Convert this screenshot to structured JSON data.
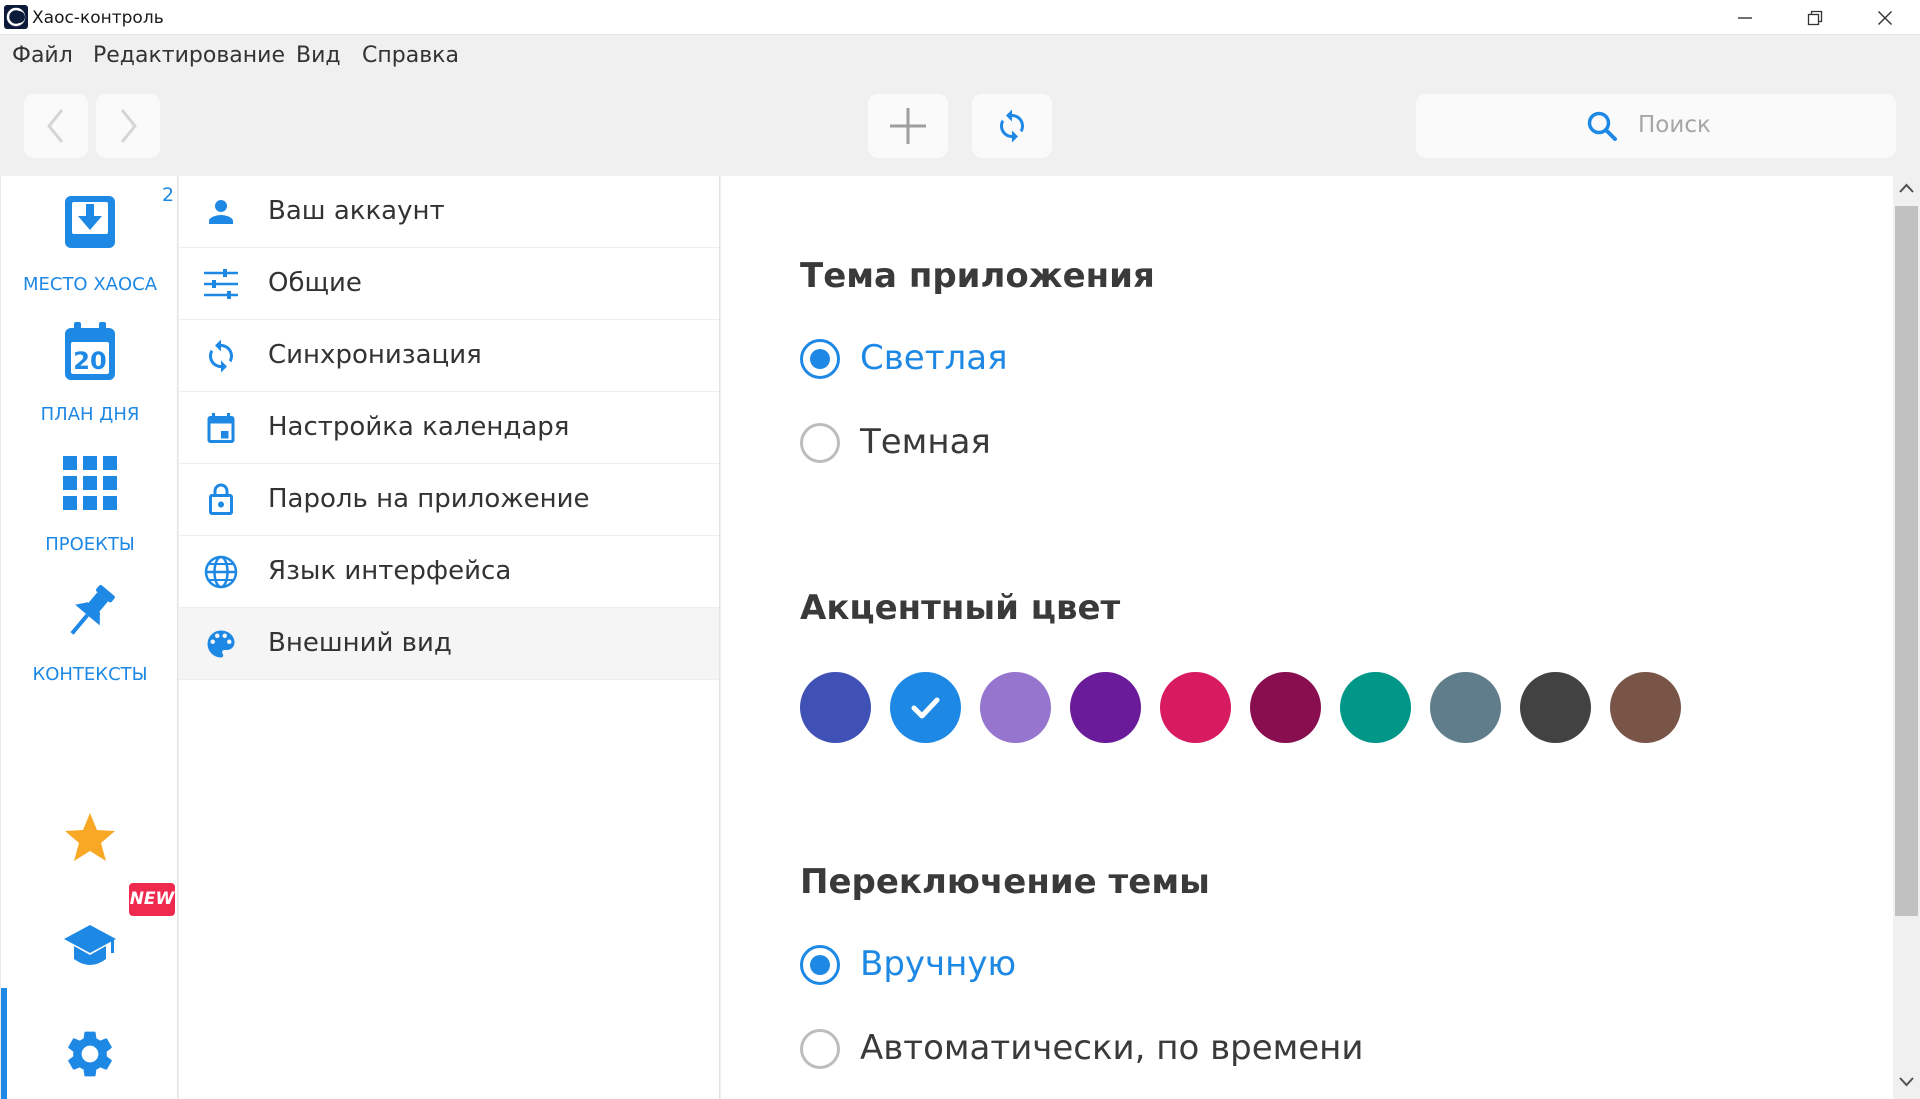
{
  "window": {
    "title": "Хаос-контроль"
  },
  "menu": [
    "Файл",
    "Редактирование",
    "Вид",
    "Справка"
  ],
  "toolbar": {
    "search_placeholder": "Поиск"
  },
  "nav": {
    "inbox_label": "МЕСТО ХАОСА",
    "inbox_count": "2",
    "day_plan_label": "ПЛАН ДНЯ",
    "day_plan_date": "20",
    "projects_label": "ПРОЕКТЫ",
    "contexts_label": "КОНТЕКСТЫ",
    "new_badge": "NEW"
  },
  "settings_menu": [
    {
      "label": "Ваш аккаунт",
      "icon": "person-icon"
    },
    {
      "label": "Общие",
      "icon": "sliders-icon"
    },
    {
      "label": "Синхронизация",
      "icon": "sync-icon"
    },
    {
      "label": "Настройка календаря",
      "icon": "calendar-icon"
    },
    {
      "label": "Пароль на приложение",
      "icon": "lock-icon"
    },
    {
      "label": "Язык интерфейса",
      "icon": "globe-icon"
    },
    {
      "label": "Внешний вид",
      "icon": "palette-icon",
      "active": true
    }
  ],
  "appearance": {
    "theme_title": "Тема приложения",
    "theme_options": [
      {
        "label": "Светлая",
        "checked": true
      },
      {
        "label": "Темная",
        "checked": false
      }
    ],
    "accent_title": "Акцентный цвет",
    "accent_colors": [
      "#3f51b5",
      "#1e88e5",
      "#9575cd",
      "#6a1b9a",
      "#d81b60",
      "#880e4f",
      "#009688",
      "#607d8b",
      "#424242",
      "#795548"
    ],
    "accent_selected": 1,
    "switch_title": "Переключение темы",
    "switch_options": [
      {
        "label": "Вручную",
        "checked": true
      },
      {
        "label": "Автоматически, по времени",
        "checked": false
      }
    ]
  },
  "colors": {
    "accent": "#1e88e5",
    "badge": "#f0294e",
    "star": "#f9a825"
  }
}
